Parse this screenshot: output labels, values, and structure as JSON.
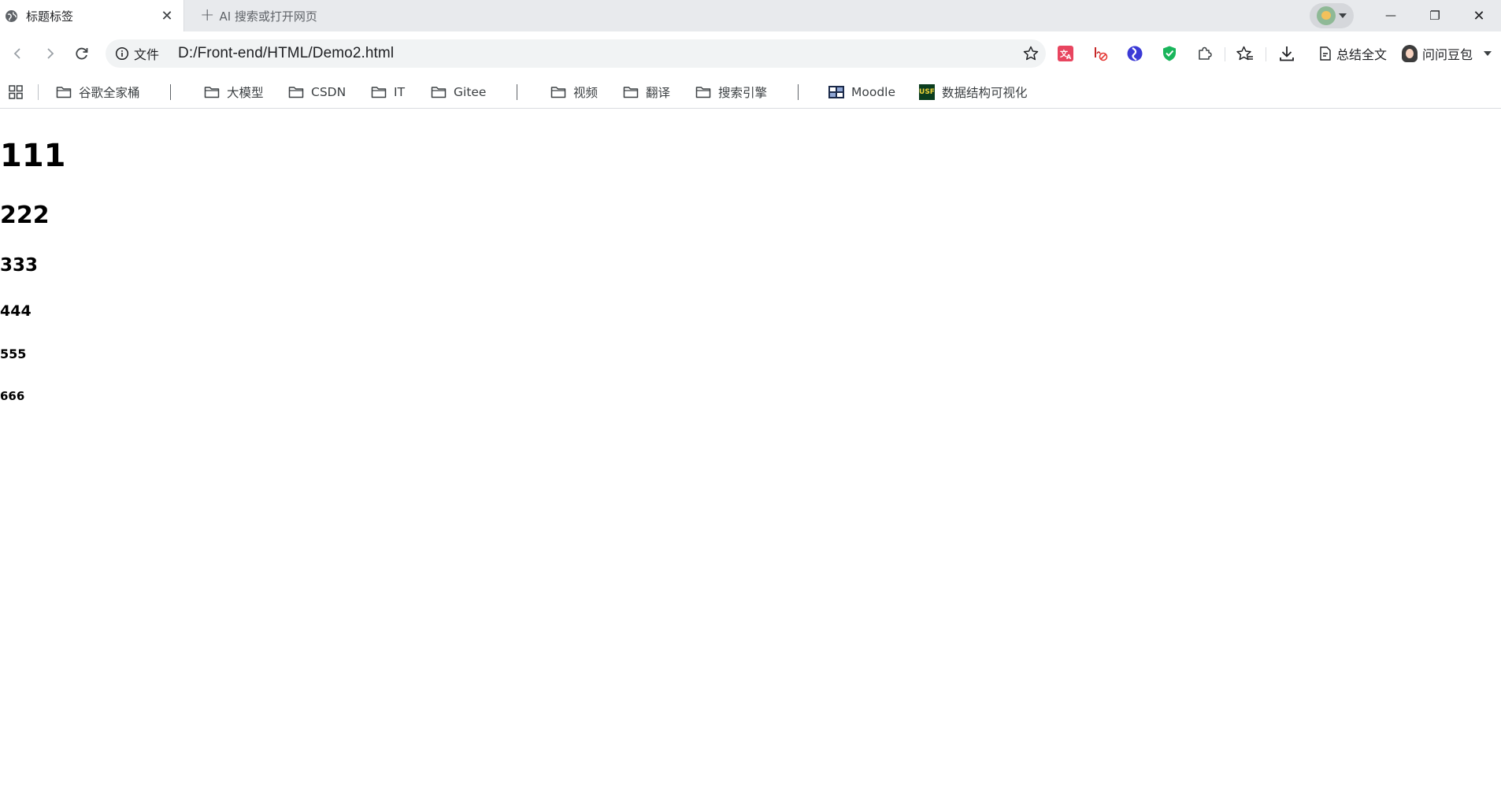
{
  "tab": {
    "title": "标题标签",
    "close_glyph": "✕"
  },
  "new_tab": {
    "plus": "+",
    "label": "AI 搜索或打开网页"
  },
  "window_controls": {
    "minimize": "—",
    "maximize": "❐",
    "close": "✕"
  },
  "omnibox": {
    "chip": "文件",
    "url": "D:/Front-end/HTML/Demo2.html"
  },
  "toolbar": {
    "summary_label": "总结全文",
    "doubao_label": "问问豆包"
  },
  "bookmarks": [
    {
      "label": "谷歌全家桶",
      "icon": "folder-icon"
    },
    {
      "label": "大模型",
      "icon": "folder-icon"
    },
    {
      "label": "CSDN",
      "icon": "folder-icon"
    },
    {
      "label": "IT",
      "icon": "folder-icon"
    },
    {
      "label": "Gitee",
      "icon": "folder-icon"
    },
    {
      "label": "视频",
      "icon": "folder-icon"
    },
    {
      "label": "翻译",
      "icon": "folder-icon"
    },
    {
      "label": "搜索引擎",
      "icon": "folder-icon"
    },
    {
      "label": "Moodle",
      "icon": "moodle-icon"
    },
    {
      "label": "数据结构可视化",
      "icon": "usf-icon",
      "icon_text": "USF"
    }
  ],
  "headings": [
    {
      "level": "h1",
      "text": "111"
    },
    {
      "level": "h2",
      "text": "222"
    },
    {
      "level": "h3",
      "text": "333"
    },
    {
      "level": "h4",
      "text": "444"
    },
    {
      "level": "h5",
      "text": "555"
    },
    {
      "level": "h6",
      "text": "666"
    }
  ],
  "colors": {
    "tabstrip_bg": "#e8eaed",
    "omnibox_bg": "#f1f3f4",
    "text": "#202124"
  }
}
